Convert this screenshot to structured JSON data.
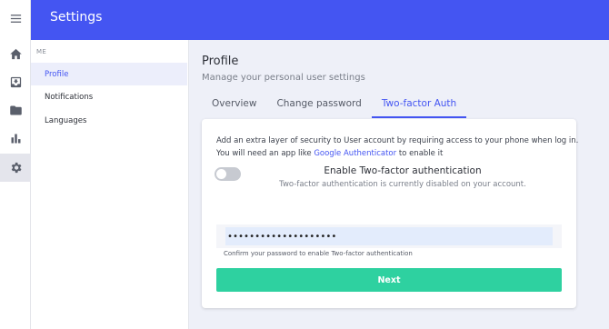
{
  "header": {
    "title": "Settings"
  },
  "rail": {
    "icons": [
      "menu-icon",
      "home-icon",
      "inbox-icon",
      "folder-icon",
      "bar-chart-icon",
      "gear-icon"
    ],
    "active": "gear-icon"
  },
  "sidebar": {
    "section": "ME",
    "items": [
      {
        "label": "Profile",
        "active": true
      },
      {
        "label": "Notifications",
        "active": false
      },
      {
        "label": "Languages",
        "active": false
      }
    ]
  },
  "main": {
    "title": "Profile",
    "subtitle": "Manage your personal user settings",
    "tabs": [
      {
        "label": "Overview",
        "active": false
      },
      {
        "label": "Change password",
        "active": false
      },
      {
        "label": "Two-factor Auth",
        "active": true
      }
    ]
  },
  "card": {
    "line1": "Add an extra layer of security to User account by requiring access to your phone when log in.",
    "line2_prefix": "You will need an app like ",
    "line2_link": "Google Authenticator",
    "line2_suffix": " to enable it",
    "toggle_on": false,
    "tfa_title": "Enable Two-factor authentication",
    "tfa_status": "Two-factor authentication is currently disabled on your account.",
    "password_value": "••••••••••••••••••••",
    "password_help": "Confirm your password to enable Two-factor authentication",
    "next_label": "Next"
  },
  "colors": {
    "accent": "#4455f2",
    "success": "#2ed1a0"
  }
}
